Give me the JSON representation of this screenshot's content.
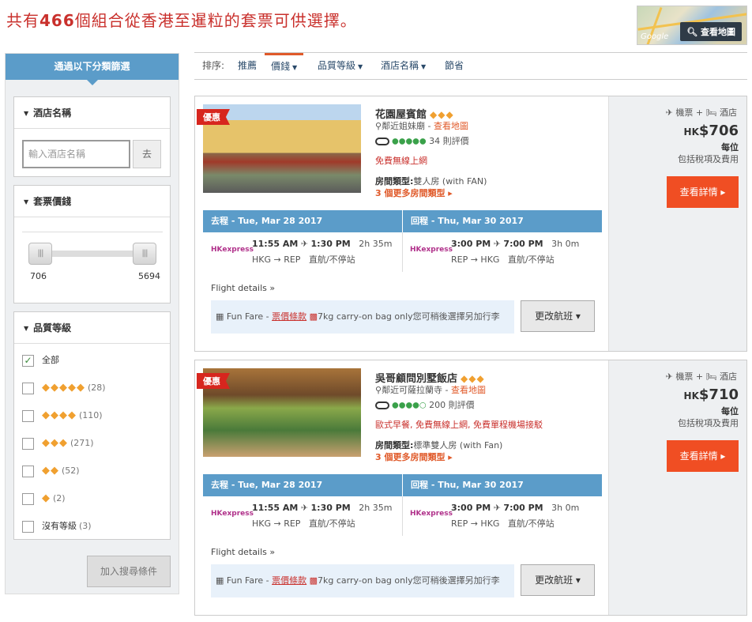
{
  "header": {
    "title_prefix": "共有",
    "title_count": "466",
    "title_suffix": "個組合從香港至暹粒的套票可供選擇。",
    "map_button": "查看地圖",
    "map_brand": "Google"
  },
  "sidebar": {
    "heading": "通過以下分類篩選",
    "hotel_name": {
      "title": "酒店名稱",
      "placeholder": "輸入酒店名稱",
      "go_label": "去"
    },
    "price": {
      "title": "套票價錢",
      "min": "706",
      "max": "5694"
    },
    "stars": {
      "title": "品質等級",
      "options": [
        {
          "label": "全部",
          "diamonds": "",
          "count": "",
          "checked": true
        },
        {
          "label": "",
          "diamonds": "◆◆◆◆◆",
          "count": "(28)",
          "checked": false
        },
        {
          "label": "",
          "diamonds": "◆◆◆◆",
          "count": "(110)",
          "checked": false
        },
        {
          "label": "",
          "diamonds": "◆◆◆",
          "count": "(271)",
          "checked": false
        },
        {
          "label": "",
          "diamonds": "◆◆",
          "count": "(52)",
          "checked": false
        },
        {
          "label": "",
          "diamonds": "◆",
          "count": "(2)",
          "checked": false
        },
        {
          "label": "沒有等級",
          "diamonds": "",
          "count": "(3)",
          "checked": false
        }
      ]
    },
    "add_search": "加入搜尋條件"
  },
  "sort": {
    "label": "排序:",
    "items": [
      "推薦",
      "價錢",
      "品質等級",
      "酒店名稱",
      "節省"
    ]
  },
  "results": [
    {
      "badge": "優惠",
      "name": "花園屋賓館",
      "diamonds": "◆◆◆",
      "near": "鄰近姐妹廟",
      "map_link": "查看地圖",
      "review_dots": "●●●●●",
      "reviews": "34 則評價",
      "perks": "免費無線上網",
      "room_label": "房間類型:",
      "room_type": "雙人房 (with FAN)",
      "more_rooms": "3 個更多房間類型 ▸",
      "package": "✈ 機票 + 🛏 酒店",
      "currency": "HK",
      "price": "$706",
      "per": "每位",
      "incl": "包括稅項及費用",
      "detail_button": "查看詳情 ▸",
      "outbound": {
        "head": "去程 - Tue, Mar 28 2017",
        "airline": "HKexpress",
        "dep": "11:55 AM",
        "arr": "1:30 PM",
        "dur": "2h 35m",
        "route": "HKG → REP",
        "stops": "直航/不停站"
      },
      "inbound": {
        "head": "回程 - Thu, Mar 30 2017",
        "airline": "HKexpress",
        "dep": "3:00 PM",
        "arr": "7:00 PM",
        "dur": "3h 0m",
        "route": "REP → HKG",
        "stops": "直航/不停站"
      },
      "flight_details": "Flight details »",
      "fare_name": "Fun Fare - ",
      "fare_rule": "票價條款",
      "bag_note": "7kg carry-on bag only您可稍後選擇另加行李",
      "change_button": "更改航班 ▾"
    },
    {
      "badge": "優惠",
      "name": "吳哥顧問別墅飯店",
      "diamonds": "◆◆◆",
      "near": "鄰近可薩拉蘭寺",
      "map_link": "查看地圖",
      "review_dots": "●●●●○",
      "reviews": "200 則評價",
      "perks": "歐式早餐, 免費無線上網, 免費單程機場接駁",
      "room_label": "房間類型:",
      "room_type": "標準雙人房 (with Fan)",
      "more_rooms": "3 個更多房間類型 ▸",
      "package": "✈ 機票 + 🛏 酒店",
      "currency": "HK",
      "price": "$710",
      "per": "每位",
      "incl": "包括稅項及費用",
      "detail_button": "查看詳情 ▸",
      "outbound": {
        "head": "去程 - Tue, Mar 28 2017",
        "airline": "HKexpress",
        "dep": "11:55 AM",
        "arr": "1:30 PM",
        "dur": "2h 35m",
        "route": "HKG → REP",
        "stops": "直航/不停站"
      },
      "inbound": {
        "head": "回程 - Thu, Mar 30 2017",
        "airline": "HKexpress",
        "dep": "3:00 PM",
        "arr": "7:00 PM",
        "dur": "3h 0m",
        "route": "REP → HKG",
        "stops": "直航/不停站"
      },
      "flight_details": "Flight details »",
      "fare_name": "Fun Fare - ",
      "fare_rule": "票價條款",
      "bag_note": "7kg carry-on bag only您可稍後選擇另加行李",
      "change_button": "更改航班 ▾"
    }
  ]
}
